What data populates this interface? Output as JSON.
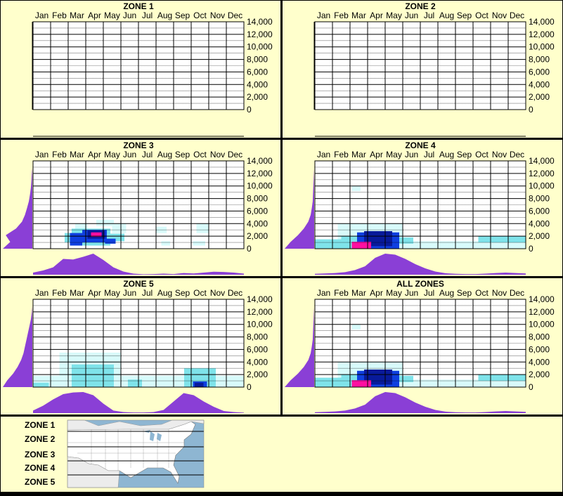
{
  "colors": {
    "background": "#ffffcc",
    "border": "#000000",
    "marginal": "#8a3fd6",
    "heat_light": "#d8fbfb",
    "heat_mid": "#7fe3ea",
    "heat_blue": "#0f3fe0",
    "heat_navy": "#081a9a",
    "heat_peak": "#ff0fa0",
    "map_water": "#8eb6d2",
    "map_land": "#ffffff"
  },
  "months": [
    "Jan",
    "Feb",
    "Mar",
    "Apr",
    "May",
    "Jun",
    "Jul",
    "Aug",
    "Sep",
    "Oct",
    "Nov",
    "Dec"
  ],
  "y_ticks": [
    "14,000",
    "12,000",
    "10,000",
    "8,000",
    "6,000",
    "4,000",
    "2,000",
    "0"
  ],
  "chart_data": [
    {
      "type": "heatmap",
      "title": "ZONE 1",
      "y_range": [
        0,
        14000
      ],
      "cells": [],
      "month_density": [],
      "elev_density": []
    },
    {
      "type": "heatmap",
      "title": "ZONE 2",
      "y_range": [
        0,
        14000
      ],
      "cells": [],
      "month_density": [],
      "elev_density": []
    },
    {
      "type": "heatmap",
      "title": "ZONE 3",
      "y_range": [
        0,
        14000
      ],
      "cells": [
        {
          "m": [
            2.4,
            3.1
          ],
          "y": [
            3000,
            4000
          ],
          "l": 1
        },
        {
          "m": [
            3.6,
            4.6
          ],
          "y": [
            3600,
            4600
          ],
          "l": 1
        },
        {
          "m": [
            1.8,
            2.4
          ],
          "y": [
            1000,
            2500
          ],
          "l": 2
        },
        {
          "m": [
            2.2,
            4.4
          ],
          "y": [
            500,
            3200
          ],
          "l": 2
        },
        {
          "m": [
            4.4,
            5.2
          ],
          "y": [
            1200,
            2400
          ],
          "l": 2
        },
        {
          "m": [
            2.1,
            2.8
          ],
          "y": [
            500,
            2500
          ],
          "l": 3
        },
        {
          "m": [
            2.8,
            4.2
          ],
          "y": [
            1000,
            3000
          ],
          "l": 3
        },
        {
          "m": [
            3.1,
            4.1
          ],
          "y": [
            1600,
            2900
          ],
          "l": 4
        },
        {
          "m": [
            3.3,
            3.9
          ],
          "y": [
            1900,
            2600
          ],
          "l": 5
        },
        {
          "m": [
            4.1,
            4.7
          ],
          "y": [
            800,
            1600
          ],
          "l": 3
        },
        {
          "m": [
            4.5,
            5.3
          ],
          "y": [
            2500,
            4000
          ],
          "l": 1
        },
        {
          "m": [
            7.0,
            7.6
          ],
          "y": [
            2500,
            3500
          ],
          "l": 1
        },
        {
          "m": [
            7.3,
            7.8
          ],
          "y": [
            500,
            1200
          ],
          "l": 1
        },
        {
          "m": [
            9.3,
            10.0
          ],
          "y": [
            2500,
            4000
          ],
          "l": 1
        },
        {
          "m": [
            9.1,
            9.8
          ],
          "y": [
            500,
            1200
          ],
          "l": 1
        }
      ],
      "month_density": [
        0.1,
        0.2,
        0.35,
        0.75,
        0.72,
        0.85,
        1.0,
        0.7,
        0.35,
        0.15,
        0.05,
        0.02,
        0.03,
        0.05,
        0.03,
        0.08,
        0.06,
        0.1,
        0.14,
        0.13,
        0.1,
        0.05
      ],
      "elev_density": [
        1.0,
        0.75,
        0.9,
        0.55,
        0.35,
        0.25,
        0.18,
        0.12,
        0.08,
        0.05,
        0.03,
        0.02,
        0.0,
        0.0
      ]
    },
    {
      "type": "heatmap",
      "title": "ZONE 4",
      "y_range": [
        0,
        14000
      ],
      "cells": [
        {
          "m": [
            0.0,
            12.0
          ],
          "y": [
            0,
            1200
          ],
          "l": 1
        },
        {
          "m": [
            0.0,
            0.6
          ],
          "y": [
            0,
            400
          ],
          "l": 3
        },
        {
          "m": [
            1.3,
            5.0
          ],
          "y": [
            0,
            4000
          ],
          "l": 1
        },
        {
          "m": [
            2.1,
            2.6
          ],
          "y": [
            9200,
            10000
          ],
          "l": 1
        },
        {
          "m": [
            0.0,
            1.8
          ],
          "y": [
            0,
            1500
          ],
          "l": 2
        },
        {
          "m": [
            1.5,
            2.4
          ],
          "y": [
            0,
            2000
          ],
          "l": 2
        },
        {
          "m": [
            2.4,
            4.8
          ],
          "y": [
            0,
            2600
          ],
          "l": 3
        },
        {
          "m": [
            2.8,
            4.4
          ],
          "y": [
            400,
            2800
          ],
          "l": 4
        },
        {
          "m": [
            2.1,
            3.0
          ],
          "y": [
            0,
            1000
          ],
          "l": 4
        },
        {
          "m": [
            2.1,
            3.2
          ],
          "y": [
            0,
            1100
          ],
          "l": 5
        },
        {
          "m": [
            4.8,
            5.6
          ],
          "y": [
            800,
            1800
          ],
          "l": 2
        },
        {
          "m": [
            9.3,
            12.0
          ],
          "y": [
            1000,
            2000
          ],
          "l": 2
        },
        {
          "m": [
            9.3,
            12.0
          ],
          "y": [
            0,
            1000
          ],
          "l": 1
        }
      ],
      "month_density": [
        0.04,
        0.06,
        0.08,
        0.12,
        0.22,
        0.4,
        0.8,
        1.0,
        0.95,
        0.75,
        0.5,
        0.3,
        0.15,
        0.07,
        0.04,
        0.03,
        0.03,
        0.05,
        0.08,
        0.1,
        0.08,
        0.06
      ],
      "elev_density": [
        1.0,
        0.8,
        0.55,
        0.35,
        0.2,
        0.12,
        0.08,
        0.05,
        0.04,
        0.03,
        0.02,
        0.01,
        0.0,
        0.0
      ]
    },
    {
      "type": "heatmap",
      "title": "ZONE 5",
      "y_range": [
        0,
        14000
      ],
      "cells": [
        {
          "m": [
            0.0,
            12.0
          ],
          "y": [
            0,
            1800
          ],
          "l": 1
        },
        {
          "m": [
            1.5,
            5.0
          ],
          "y": [
            0,
            5500
          ],
          "l": 1
        },
        {
          "m": [
            2.2,
            4.6
          ],
          "y": [
            0,
            3600
          ],
          "l": 2
        },
        {
          "m": [
            2.5,
            3.6
          ],
          "y": [
            1000,
            2500
          ],
          "l": 2
        },
        {
          "m": [
            8.6,
            10.4
          ],
          "y": [
            0,
            3000
          ],
          "l": 2
        },
        {
          "m": [
            9.1,
            9.9
          ],
          "y": [
            0,
            900
          ],
          "l": 3
        },
        {
          "m": [
            9.2,
            9.7
          ],
          "y": [
            0,
            700
          ],
          "l": 4
        },
        {
          "m": [
            0.0,
            0.9
          ],
          "y": [
            0,
            700
          ],
          "l": 2
        },
        {
          "m": [
            5.4,
            6.2
          ],
          "y": [
            0,
            1200
          ],
          "l": 2
        }
      ],
      "month_density": [
        0.12,
        0.35,
        0.65,
        0.9,
        0.98,
        1.0,
        0.85,
        0.45,
        0.12,
        0.05,
        0.03,
        0.03,
        0.05,
        0.15,
        0.55,
        0.95,
        0.85,
        0.55,
        0.3,
        0.1,
        0.05,
        0.02
      ],
      "elev_density": [
        1.0,
        0.85,
        0.65,
        0.5,
        0.38,
        0.3,
        0.25,
        0.2,
        0.15,
        0.1,
        0.05,
        0.02,
        0.0,
        0.0
      ]
    },
    {
      "type": "heatmap",
      "title": "ALL ZONES",
      "y_range": [
        0,
        14000
      ],
      "cells": [
        {
          "m": [
            0.0,
            12.0
          ],
          "y": [
            0,
            1200
          ],
          "l": 1
        },
        {
          "m": [
            0.0,
            0.6
          ],
          "y": [
            0,
            400
          ],
          "l": 3
        },
        {
          "m": [
            1.3,
            5.0
          ],
          "y": [
            0,
            4000
          ],
          "l": 1
        },
        {
          "m": [
            2.1,
            2.6
          ],
          "y": [
            9200,
            10000
          ],
          "l": 1
        },
        {
          "m": [
            0.0,
            1.8
          ],
          "y": [
            0,
            1500
          ],
          "l": 2
        },
        {
          "m": [
            1.5,
            2.4
          ],
          "y": [
            0,
            2000
          ],
          "l": 2
        },
        {
          "m": [
            2.4,
            4.8
          ],
          "y": [
            0,
            2600
          ],
          "l": 3
        },
        {
          "m": [
            2.8,
            4.4
          ],
          "y": [
            400,
            2800
          ],
          "l": 4
        },
        {
          "m": [
            2.1,
            3.0
          ],
          "y": [
            0,
            1000
          ],
          "l": 4
        },
        {
          "m": [
            2.1,
            3.2
          ],
          "y": [
            0,
            1100
          ],
          "l": 5
        },
        {
          "m": [
            4.8,
            5.6
          ],
          "y": [
            800,
            1800
          ],
          "l": 2
        },
        {
          "m": [
            9.3,
            12.0
          ],
          "y": [
            1000,
            2000
          ],
          "l": 2
        },
        {
          "m": [
            9.3,
            12.0
          ],
          "y": [
            0,
            1000
          ],
          "l": 1
        }
      ],
      "month_density": [
        0.04,
        0.06,
        0.08,
        0.12,
        0.22,
        0.4,
        0.8,
        1.0,
        0.95,
        0.75,
        0.5,
        0.3,
        0.15,
        0.07,
        0.04,
        0.03,
        0.03,
        0.05,
        0.08,
        0.1,
        0.08,
        0.06
      ],
      "elev_density": [
        1.0,
        0.8,
        0.55,
        0.35,
        0.2,
        0.12,
        0.08,
        0.05,
        0.04,
        0.03,
        0.02,
        0.01,
        0.0,
        0.0
      ]
    }
  ],
  "legend": {
    "zones": [
      "ZONE 1",
      "ZONE 2",
      "ZONE 3",
      "ZONE 4",
      "ZONE 5"
    ]
  }
}
